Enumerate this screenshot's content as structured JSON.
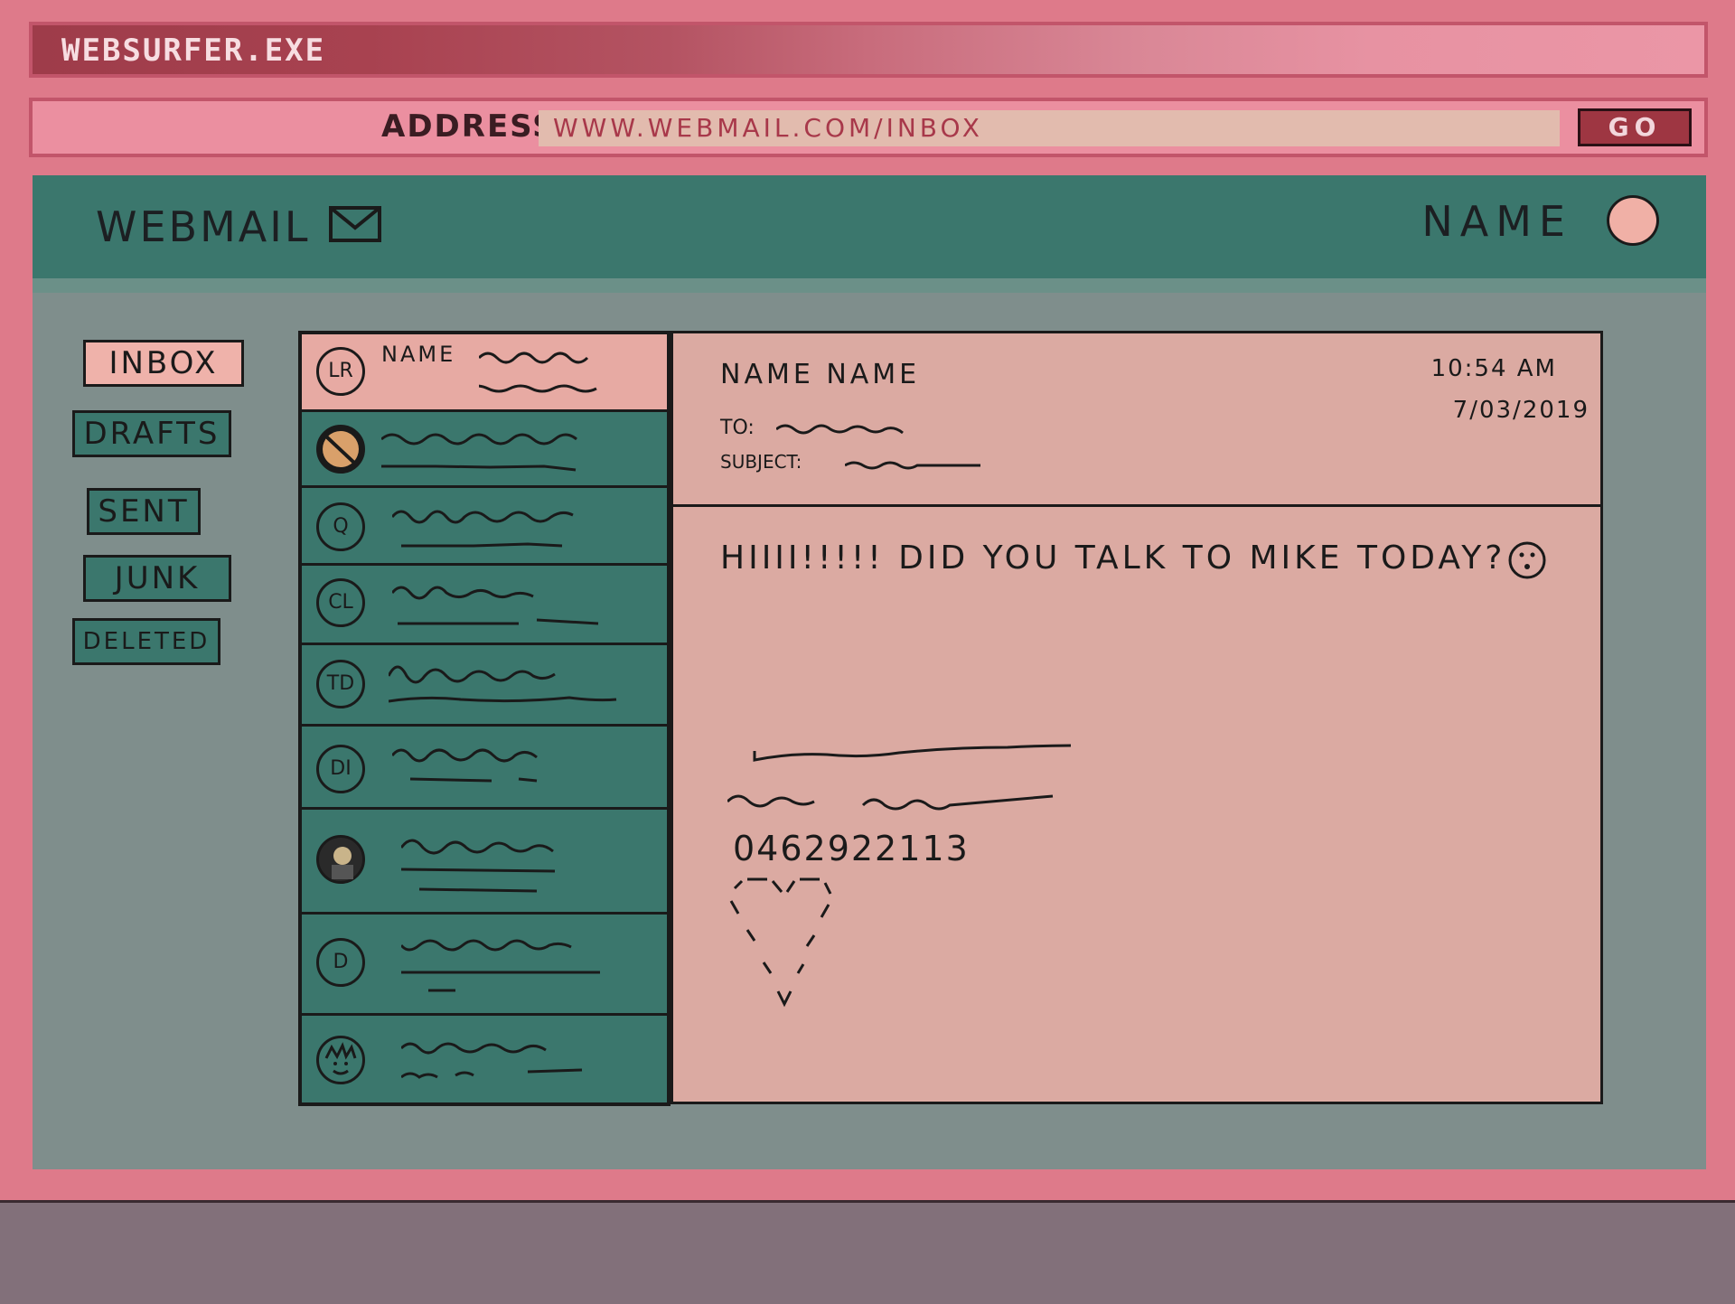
{
  "window": {
    "title": "WEBSURFER.EXE"
  },
  "address_bar": {
    "label": "ADDRESS:",
    "url": "WWW.WEBMAIL.COM/INBOX",
    "go_label": "GO"
  },
  "app": {
    "title": "WEBMAIL",
    "user_name": "NAME"
  },
  "folders": [
    "INBOX",
    "DRAFTS",
    "SENT",
    "JUNK",
    "DELETED"
  ],
  "messages": [
    {
      "avatar": "LR",
      "sender": "NAME"
    },
    {
      "avatar": ""
    },
    {
      "avatar": "Q"
    },
    {
      "avatar": "CL"
    },
    {
      "avatar": "TD"
    },
    {
      "avatar": "DI"
    },
    {
      "avatar": ""
    },
    {
      "avatar": "D"
    },
    {
      "avatar": ""
    }
  ],
  "email": {
    "from": "NAME NAME",
    "time": "10:54 AM",
    "date": "7/03/2019",
    "to_label": "TO:",
    "subject_label": "SUBJECT:",
    "body": "HIIII!!!!! DID YOU TALK TO MIKE TODAY?",
    "phone": "0462922113"
  },
  "colors": {
    "frame": "#de7a8a",
    "header_teal": "#3b776d",
    "pane_pink": "#dbaaa2",
    "app_bg": "#7f8e8c"
  }
}
